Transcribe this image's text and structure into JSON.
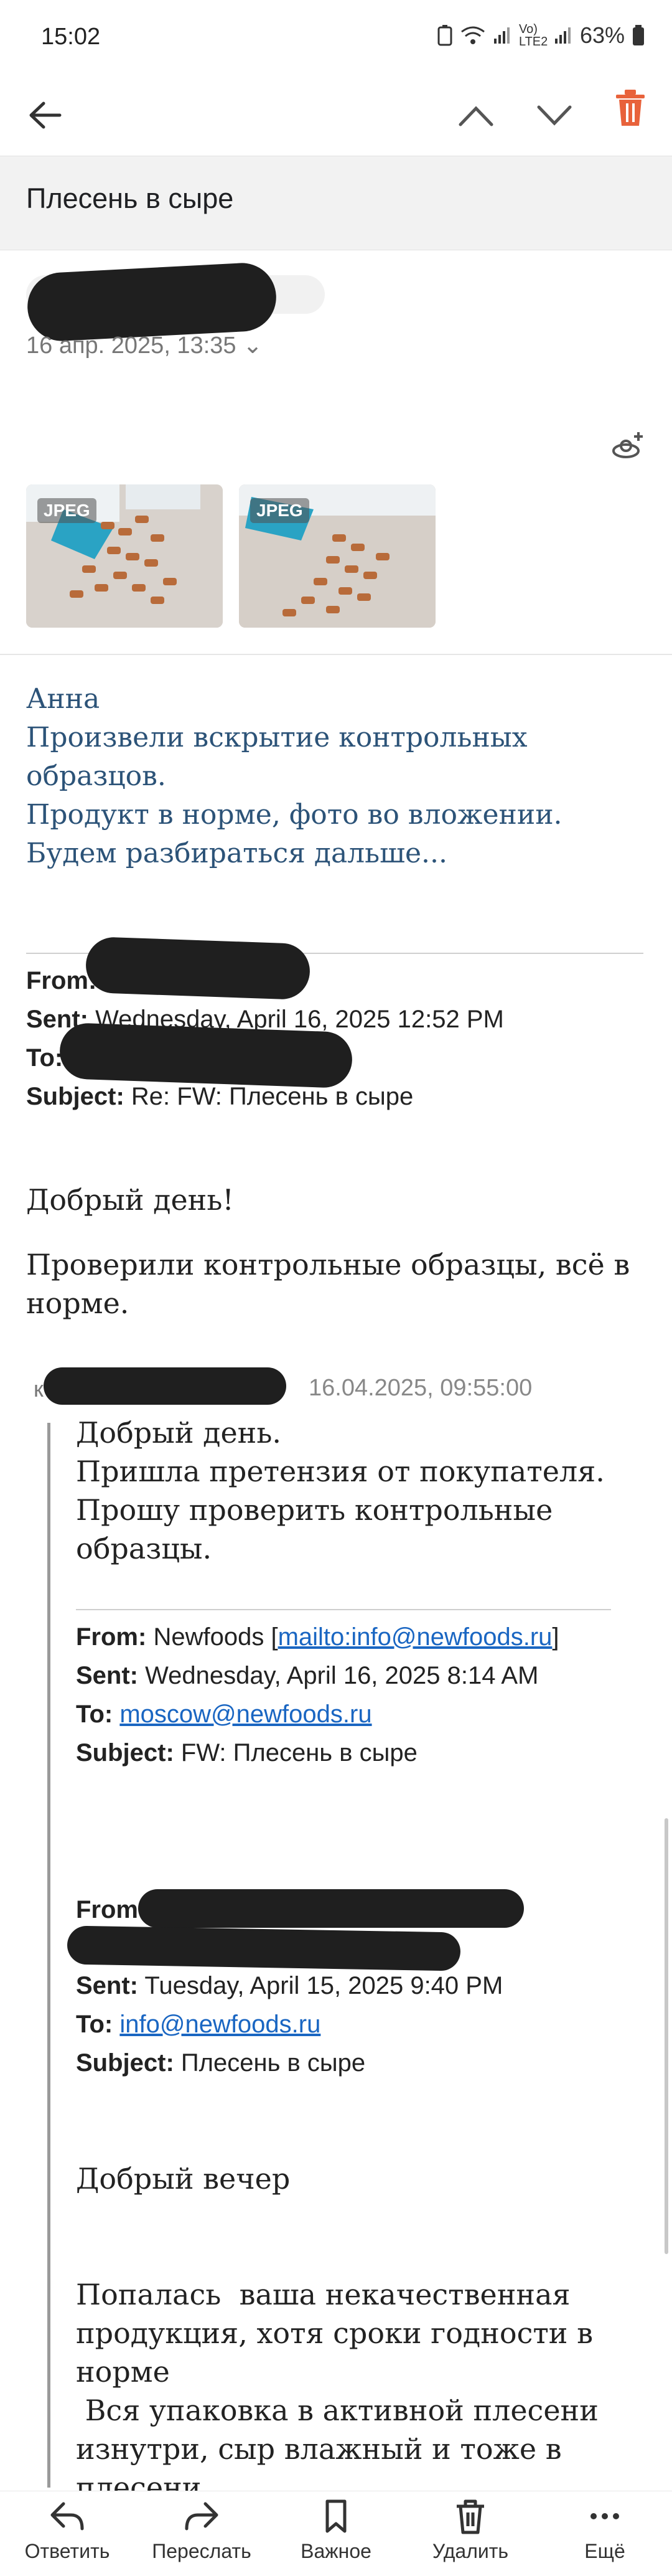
{
  "status_bar": {
    "time": "15:02",
    "network": "Vo) LTE2",
    "battery": "63%"
  },
  "header": {
    "back_icon": "arrow-left-icon",
    "prev_icon": "chevron-up-icon",
    "next_icon": "chevron-down-icon",
    "delete_icon": "trash-icon"
  },
  "subject": "Плесень в сыре",
  "sender": {
    "date": "16 апр. 2025, 13:35 ⌄"
  },
  "attachments": [
    {
      "type": "JPEG"
    },
    {
      "type": "JPEG"
    }
  ],
  "reply_lines": [
    "Анна",
    "Произвели вскрытие контрольных",
    "образцов.",
    "Продукт в норме, фото во вложении.",
    "Будем разбираться дальше..."
  ],
  "quote1": {
    "from_label": "From:",
    "sent_label": "Sent:",
    "sent_value": "Wednesday, April 16, 2025 12:52 PM",
    "to_label": "To:",
    "subject_label": "Subject:",
    "subject_value": "Re: FW: Плесень в сыре",
    "greeting": "Добрый день!",
    "body": "Проверили контрольные образцы, всё в норме."
  },
  "quote2": {
    "date": "16.04.2025, 09:55:00",
    "body_lines": [
      "Добрый день.",
      "Пришла претензия от покупателя.",
      "Прошу проверить контрольные",
      "образцы."
    ],
    "from_label": "From:",
    "from_name": "Newfoods [",
    "from_link": "mailto:info@newfoods.ru",
    "from_end": "]",
    "sent_label": "Sent:",
    "sent_value": "Wednesday, April 16, 2025 8:14 AM",
    "to_label": "To:",
    "to_link": "moscow@newfoods.ru",
    "subject_label": "Subject:",
    "subject_value": "FW: Плесень в сыре"
  },
  "quote3": {
    "from_label": "From",
    "sent_label": "Sent:",
    "sent_value": "Tuesday, April 15, 2025 9:40 PM",
    "to_label": "To:",
    "to_link": "info@newfoods.ru",
    "subject_label": "Subject:",
    "subject_value": "Плесень в сыре",
    "greeting": "Добрый вечер",
    "body_lines": [
      "Попалась  ваша некачественная",
      "продукция, хотя сроки годности в",
      "норме",
      " Вся упаковка в активной плесени",
      "изнутри, сыр влажный и тоже в",
      "плесени."
    ]
  },
  "bottom_actions": [
    {
      "label": "Ответить",
      "icon": "reply-icon"
    },
    {
      "label": "Переслать",
      "icon": "forward-icon"
    },
    {
      "label": "Важное",
      "icon": "bookmark-icon"
    },
    {
      "label": "Удалить",
      "icon": "trash-icon"
    },
    {
      "label": "Ещё",
      "icon": "more-icon"
    }
  ],
  "colors": {
    "accent_red": "#e8623b",
    "link": "#1a66c2",
    "reply_text": "#2c5378"
  }
}
